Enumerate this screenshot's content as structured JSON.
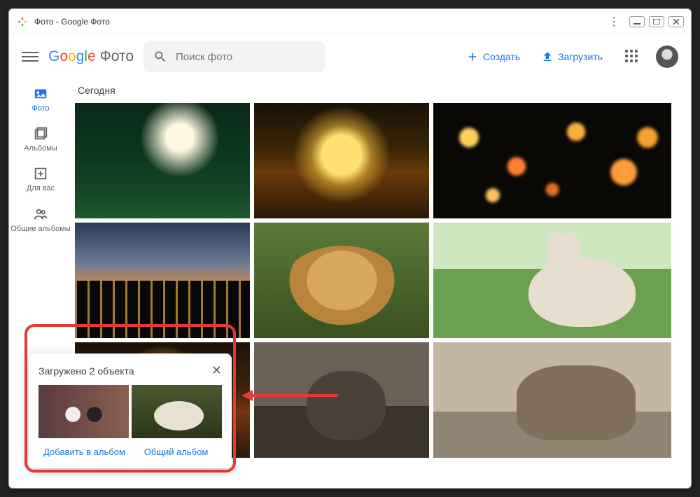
{
  "window": {
    "title": "Фото - Google Фото"
  },
  "logo": {
    "product": "Фото"
  },
  "search": {
    "placeholder": "Поиск фото"
  },
  "header": {
    "create": "Создать",
    "upload": "Загрузить"
  },
  "sidebar": {
    "items": [
      {
        "label": "Фото",
        "icon": "photo-icon",
        "active": true
      },
      {
        "label": "Альбомы",
        "icon": "albums-icon",
        "active": false
      },
      {
        "label": "Для вас",
        "icon": "for-you-icon",
        "active": false
      },
      {
        "label": "Общие альбомы",
        "icon": "shared-icon",
        "active": false
      }
    ]
  },
  "section": {
    "date": "Сегодня"
  },
  "toast": {
    "title": "Загружено 2 объекта",
    "add_to_album": "Добавить в альбом",
    "shared_album": "Общий альбом"
  }
}
